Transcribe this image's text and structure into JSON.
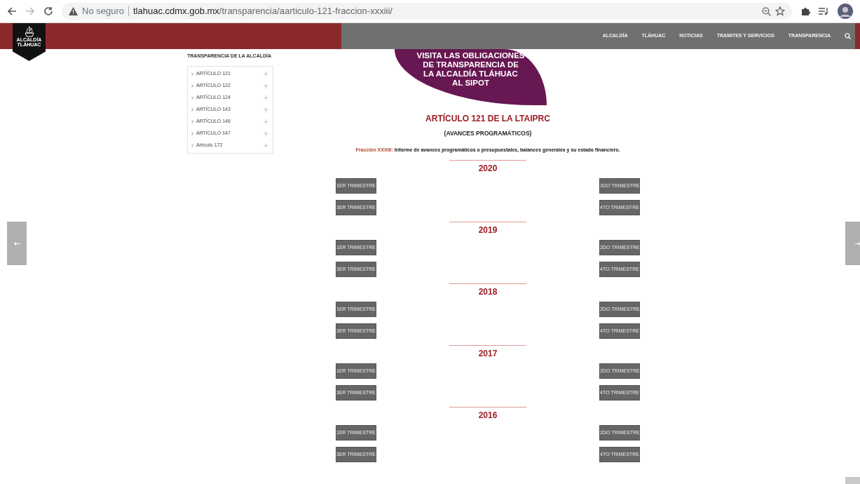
{
  "browser": {
    "security": "No seguro",
    "host": "tlahuac.cdmx.gob.mx",
    "path": "/transparencia/aarticulo-121-fraccion-xxxiii/"
  },
  "header": {
    "logo_lines": [
      "ALCALDÍA",
      "TLÁHUAC"
    ],
    "menu": [
      "ALCALDÍA",
      "TLÁHUAC",
      "NOTICIAS",
      "TRAMITES Y SERVICIOS",
      "TRANSPARENCIA"
    ]
  },
  "sidebar": {
    "title": "TRANSPARENCIA DE LA ALCALDÍA",
    "items": [
      {
        "label": "ARTÍCULO 121"
      },
      {
        "label": "ARTÍCULO 122"
      },
      {
        "label": "ARTÍCULO 124"
      },
      {
        "label": "ARTÍCULO 143"
      },
      {
        "label": "ARTÍCULO 146"
      },
      {
        "label": "ARTÍCULO 147"
      },
      {
        "label": "Artículo 172"
      }
    ]
  },
  "banner": {
    "lines": [
      "VISITA LAS OBLIGACIONES",
      "DE TRANSPARENCIA DE",
      "LA ALCALDÍA TLÁHUAC",
      "AL SIPOT"
    ]
  },
  "title": "ARTÍCULO 121 DE LA LTAIPRC",
  "subtitle": "(AVANCES PROGRAMÁTICOS)",
  "fraction": {
    "label": "Fracción XXXIII:",
    "text": "Informe de avances programáticos o presupuestales, balances generales y su estado financiero."
  },
  "years": [
    {
      "year": "2020",
      "quarters": [
        "1ER TRIMESTRE",
        "2DO TRIMESTRE",
        "3ER TRIMESTRE",
        "4TO TRIMESTRE"
      ]
    },
    {
      "year": "2019",
      "quarters": [
        "1ER TRIMESTRE",
        "2DO TRIMESTRE",
        "3ER TRIMESTRE",
        "4TO TRIMESTRE"
      ]
    },
    {
      "year": "2018",
      "quarters": [
        "1ER TRIMESTRE",
        "2DO TRIMESTRE",
        "3ER TRIMESTRE",
        "4TO TRIMESTRE"
      ]
    },
    {
      "year": "2017",
      "quarters": [
        "1ER TRIMESTRE",
        "2DO TRIMESTRE",
        "3ER TRIMESTRE",
        "4TO TRIMESTRE"
      ]
    },
    {
      "year": "2016",
      "quarters": [
        "1ER TRIMESTRE",
        "2DO TRIMESTRE",
        "3ER TRIMESTRE",
        "4TO TRIMESTRE"
      ]
    }
  ]
}
